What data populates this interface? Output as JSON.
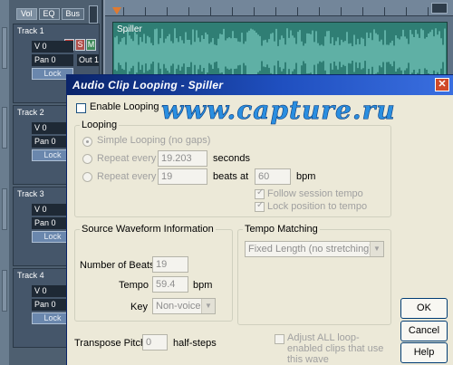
{
  "daw": {
    "tabs": [
      "Vol",
      "EQ",
      "Bus"
    ],
    "tracks": [
      {
        "name": "Track 1",
        "volume": "V 0",
        "pan": "Pan 0",
        "lock": "Lock",
        "out": "Out 1",
        "r": "R",
        "s": "S",
        "m": "M"
      },
      {
        "name": "Track 2",
        "volume": "V 0",
        "pan": "Pan 0",
        "lock": "Lock"
      },
      {
        "name": "Track 3",
        "volume": "V 0",
        "pan": "Pan 0",
        "lock": "Lock"
      },
      {
        "name": "Track 4",
        "volume": "V 0",
        "pan": "Pan 0",
        "lock": "Lock"
      }
    ],
    "clip_name": "Spiller",
    "colors": {
      "clip": "#2f7e74",
      "waveform": "#8fe3d6"
    }
  },
  "dialog": {
    "title": "Audio Clip Looping - Spiller",
    "watermark": "www.capture.ru",
    "enable_looping": {
      "label": "Enable Looping",
      "checked": false
    },
    "looping": {
      "title": "Looping",
      "simple": "Simple Looping (no gaps)",
      "repeat_seconds_label": "Repeat every",
      "repeat_seconds_value": "19.203",
      "seconds_unit": "seconds",
      "repeat_beats_label": "Repeat every",
      "repeat_beats_value": "19",
      "beats_at": "beats at",
      "bpm_value": "60",
      "bpm_unit": "bpm",
      "follow_tempo": "Follow session tempo",
      "lock_position": "Lock position to tempo"
    },
    "source": {
      "title": "Source Waveform Information",
      "beats_label": "Number of Beats",
      "beats_value": "19",
      "tempo_label": "Tempo",
      "tempo_value": "59.4",
      "tempo_unit": "bpm",
      "key_label": "Key",
      "key_value": "Non-voiced"
    },
    "tempo_matching": {
      "title": "Tempo Matching",
      "value": "Fixed Length (no stretching)"
    },
    "transpose": {
      "label": "Transpose Pitch",
      "value": "0",
      "unit": "half-steps"
    },
    "adjust_all": "Adjust ALL loop-enabled clips that use this wave",
    "buttons": {
      "ok": "OK",
      "cancel": "Cancel",
      "help": "Help"
    }
  }
}
